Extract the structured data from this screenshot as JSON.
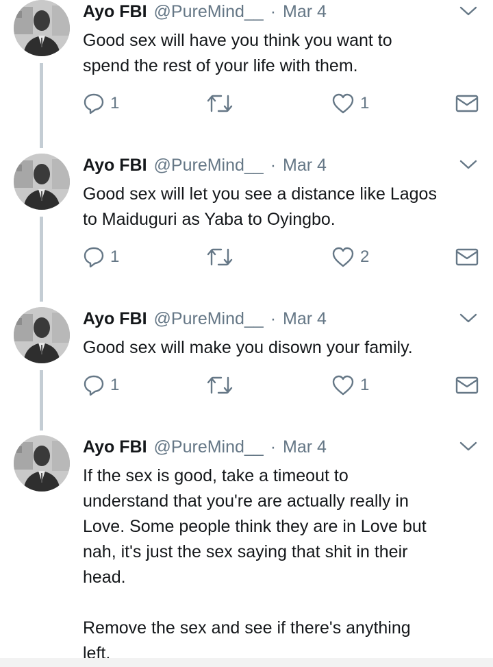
{
  "tweets": [
    {
      "name": "Ayo FBI",
      "handle": "@PureMind__",
      "dot": "·",
      "date": "Mar 4",
      "text": "Good sex will have you think you want to\nspend the rest of your life with them.",
      "replies": "1",
      "retweets": "",
      "likes": "1"
    },
    {
      "name": "Ayo FBI",
      "handle": "@PureMind__",
      "dot": "·",
      "date": "Mar 4",
      "text": "Good sex will let you see a distance like Lagos\nto Maiduguri as Yaba to Oyingbo.",
      "replies": "1",
      "retweets": "",
      "likes": "2"
    },
    {
      "name": "Ayo FBI",
      "handle": "@PureMind__",
      "dot": "·",
      "date": "Mar 4",
      "text": "Good sex will make you disown your family.",
      "replies": "1",
      "retweets": "",
      "likes": "1"
    },
    {
      "name": "Ayo FBI",
      "handle": "@PureMind__",
      "dot": "·",
      "date": "Mar 4",
      "text": "If the sex is good, take a timeout to\nunderstand that you're are actually really in\nLove. Some people think they are in Love but\nnah, it's just the sex saying that shit in their\nhead.\n\nRemove the sex and see if there's anything\nleft."
    }
  ],
  "icons": {
    "chevron": "chevron-down-icon",
    "reply": "reply-icon",
    "retweet": "retweet-icon",
    "like": "heart-icon",
    "dm": "envelope-icon"
  },
  "colors": {
    "icon_gray": "#657786",
    "thread_line": "#c4cdd4",
    "text": "#14171a"
  }
}
